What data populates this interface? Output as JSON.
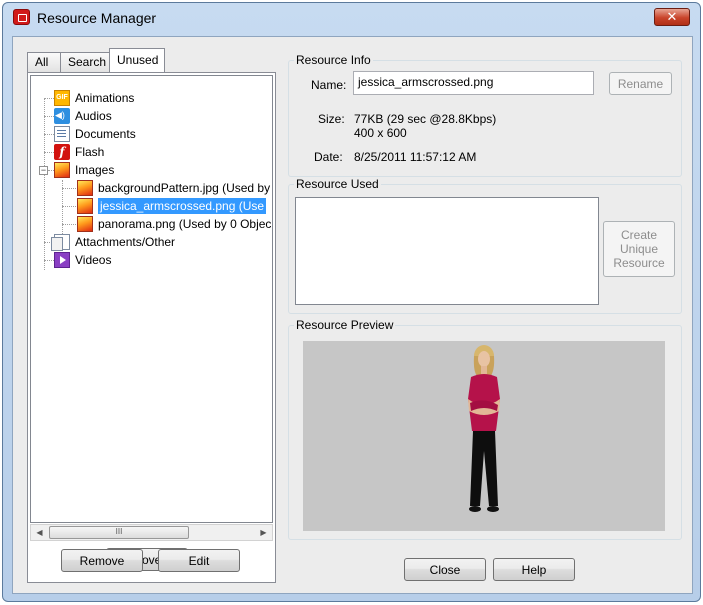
{
  "window": {
    "title": "Resource Manager",
    "close_label": "✕"
  },
  "tabs": [
    {
      "label": "All"
    },
    {
      "label": "Search"
    },
    {
      "label": "Unused"
    }
  ],
  "tree": {
    "items": [
      {
        "label": "Animations",
        "icon": "gif-icon"
      },
      {
        "label": "Audios",
        "icon": "audio-icon"
      },
      {
        "label": "Documents",
        "icon": "document-icon"
      },
      {
        "label": "Flash",
        "icon": "flash-icon"
      },
      {
        "label": "Images",
        "icon": "image-icon",
        "expander": "−"
      },
      {
        "label": "backgroundPattern.jpg (Used by",
        "icon": "image-icon"
      },
      {
        "label": "jessica_armscrossed.png (Use",
        "icon": "image-icon",
        "selected": true
      },
      {
        "label": "panorama.png (Used by 0 Objec",
        "icon": "image-icon"
      },
      {
        "label": "Attachments/Other",
        "icon": "attachment-icon"
      },
      {
        "label": "Videos",
        "icon": "video-icon"
      }
    ],
    "gif_text": "GIF",
    "flash_text": "f",
    "scroll_left": "◀",
    "scroll_right": "▶",
    "scroll_grip": "III"
  },
  "left_buttons": {
    "remove_all": "Remove All",
    "remove": "Remove",
    "edit": "Edit"
  },
  "resource_info": {
    "title": "Resource Info",
    "name_label": "Name:",
    "name_value": "jessica_armscrossed.png",
    "rename_label": "Rename",
    "size_label": "Size:",
    "size_value": "77KB (29 sec @28.8Kbps)",
    "dimensions": "400 x 600",
    "date_label": "Date:",
    "date_value": "8/25/2011 11:57:12 AM"
  },
  "resource_used": {
    "title": "Resource Used",
    "create_line1": "Create",
    "create_line2": "Unique",
    "create_line3": "Resource"
  },
  "resource_preview": {
    "title": "Resource Preview"
  },
  "bottom_buttons": {
    "close": "Close",
    "help": "Help"
  },
  "colors": {
    "selection": "#3399ff",
    "preview_bg": "#c6c6c6",
    "shirt": "#b5124a"
  }
}
